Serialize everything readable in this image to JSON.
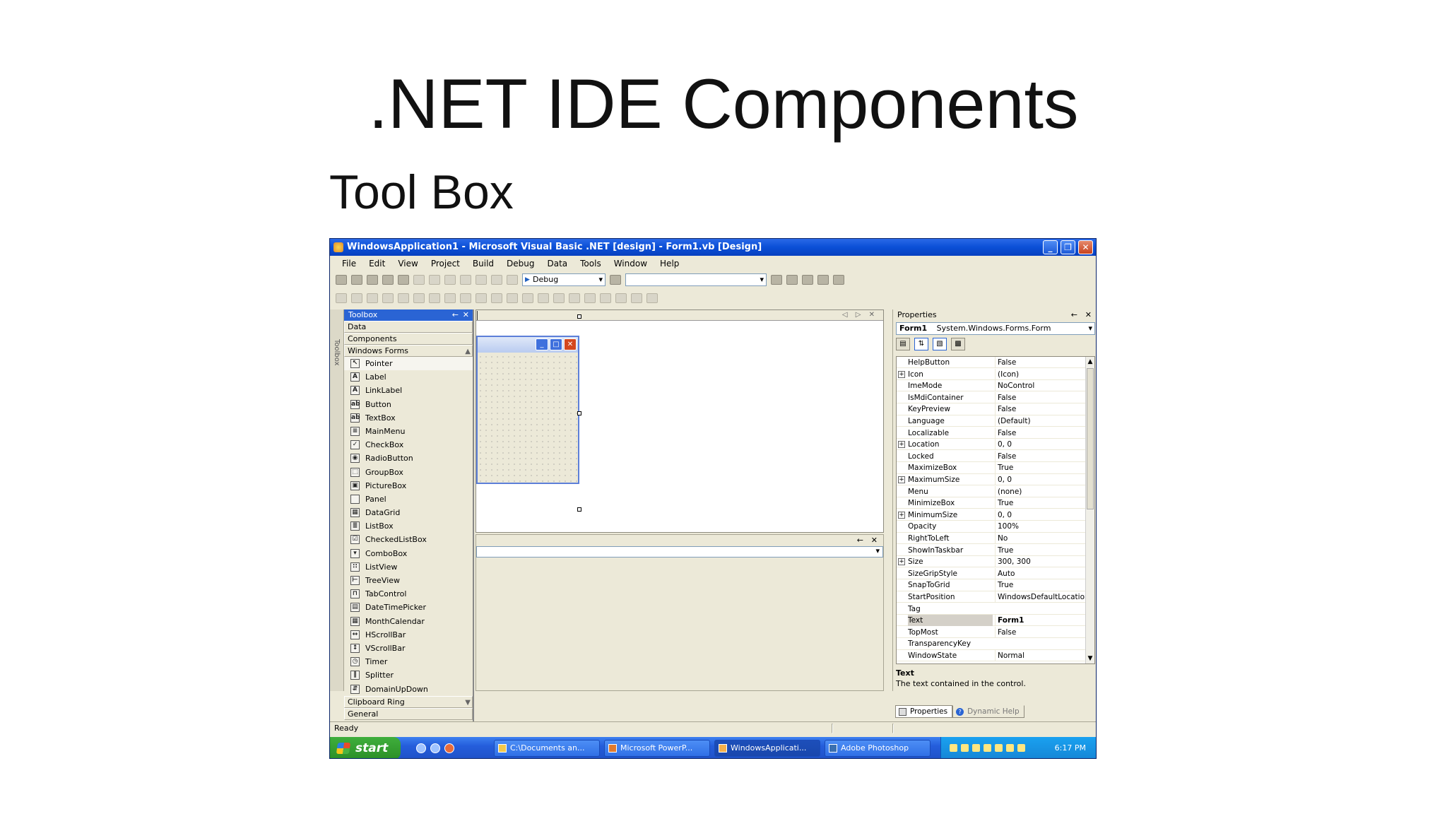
{
  "slide": {
    "title": ".NET IDE Components",
    "subtitle": "Tool Box"
  },
  "window": {
    "title": "WindowsApplication1 - Microsoft Visual Basic .NET [design] - Form1.vb [Design]",
    "minimize": "_",
    "maximize": "❐",
    "close": "✕"
  },
  "menu": [
    "File",
    "Edit",
    "View",
    "Project",
    "Build",
    "Debug",
    "Data",
    "Tools",
    "Window",
    "Help"
  ],
  "toolbar": {
    "config": "Debug"
  },
  "toolbox": {
    "title": "Toolbox",
    "pin": "←",
    "close": "✕",
    "strip_label": "Toolbox",
    "tabs": [
      "Data",
      "Components",
      "Windows Forms"
    ],
    "items": [
      {
        "label": "Pointer",
        "icon": "↖"
      },
      {
        "label": "Label",
        "icon": "A"
      },
      {
        "label": "LinkLabel",
        "icon": "A"
      },
      {
        "label": "Button",
        "icon": "ab"
      },
      {
        "label": "TextBox",
        "icon": "ab"
      },
      {
        "label": "MainMenu",
        "icon": "≡"
      },
      {
        "label": "CheckBox",
        "icon": "✓"
      },
      {
        "label": "RadioButton",
        "icon": "◉"
      },
      {
        "label": "GroupBox",
        "icon": "⬚"
      },
      {
        "label": "PictureBox",
        "icon": "▣"
      },
      {
        "label": "Panel",
        "icon": ""
      },
      {
        "label": "DataGrid",
        "icon": "▦"
      },
      {
        "label": "ListBox",
        "icon": "≣"
      },
      {
        "label": "CheckedListBox",
        "icon": "☑"
      },
      {
        "label": "ComboBox",
        "icon": "▾"
      },
      {
        "label": "ListView",
        "icon": "∷"
      },
      {
        "label": "TreeView",
        "icon": "⊢"
      },
      {
        "label": "TabControl",
        "icon": "⊓"
      },
      {
        "label": "DateTimePicker",
        "icon": "▤"
      },
      {
        "label": "MonthCalendar",
        "icon": "▦"
      },
      {
        "label": "HScrollBar",
        "icon": "↔"
      },
      {
        "label": "VScrollBar",
        "icon": "↕"
      },
      {
        "label": "Timer",
        "icon": "◷"
      },
      {
        "label": "Splitter",
        "icon": "∥"
      },
      {
        "label": "DomainUpDown",
        "icon": "⇵"
      }
    ],
    "bottom_tabs": [
      "Clipboard Ring",
      "General"
    ]
  },
  "designer": {
    "nav": "◁ ▷ ✕"
  },
  "output": {
    "pin": "←",
    "close": "✕"
  },
  "properties": {
    "title": "Properties",
    "pin": "←",
    "close": "✕",
    "object_name": "Form1",
    "object_type": "System.Windows.Forms.Form",
    "rows": [
      {
        "name": "HelpButton",
        "value": "False",
        "expand": false
      },
      {
        "name": "Icon",
        "value": "(Icon)",
        "expand": true
      },
      {
        "name": "ImeMode",
        "value": "NoControl",
        "expand": false
      },
      {
        "name": "IsMdiContainer",
        "value": "False",
        "expand": false
      },
      {
        "name": "KeyPreview",
        "value": "False",
        "expand": false
      },
      {
        "name": "Language",
        "value": "(Default)",
        "expand": false
      },
      {
        "name": "Localizable",
        "value": "False",
        "expand": false
      },
      {
        "name": "Location",
        "value": "0, 0",
        "expand": true
      },
      {
        "name": "Locked",
        "value": "False",
        "expand": false
      },
      {
        "name": "MaximizeBox",
        "value": "True",
        "expand": false
      },
      {
        "name": "MaximumSize",
        "value": "0, 0",
        "expand": true
      },
      {
        "name": "Menu",
        "value": "(none)",
        "expand": false
      },
      {
        "name": "MinimizeBox",
        "value": "True",
        "expand": false
      },
      {
        "name": "MinimumSize",
        "value": "0, 0",
        "expand": true
      },
      {
        "name": "Opacity",
        "value": "100%",
        "expand": false
      },
      {
        "name": "RightToLeft",
        "value": "No",
        "expand": false
      },
      {
        "name": "ShowInTaskbar",
        "value": "True",
        "expand": false
      },
      {
        "name": "Size",
        "value": "300, 300",
        "expand": true
      },
      {
        "name": "SizeGripStyle",
        "value": "Auto",
        "expand": false
      },
      {
        "name": "SnapToGrid",
        "value": "True",
        "expand": false
      },
      {
        "name": "StartPosition",
        "value": "WindowsDefaultLocation",
        "expand": false
      },
      {
        "name": "Tag",
        "value": "",
        "expand": false
      },
      {
        "name": "Text",
        "value": "Form1",
        "expand": false,
        "selected": true
      },
      {
        "name": "TopMost",
        "value": "False",
        "expand": false
      },
      {
        "name": "TransparencyKey",
        "value": "",
        "expand": false
      },
      {
        "name": "WindowState",
        "value": "Normal",
        "expand": false
      }
    ],
    "desc_title": "Text",
    "desc_text": "The text contained in the control.",
    "tabs": [
      "Properties",
      "Dynamic Help"
    ]
  },
  "status": {
    "text": "Ready"
  },
  "taskbar": {
    "start": "start",
    "tasks": [
      "C:\\Documents an...",
      "Microsoft PowerP...",
      "WindowsApplicati...",
      "Adobe Photoshop"
    ],
    "clock": "6:17 PM"
  },
  "colors": {
    "titlebar": "#0a4fd6",
    "chrome": "#ece9d8",
    "taskbar": "#245ddb",
    "start": "#3fae3c"
  }
}
